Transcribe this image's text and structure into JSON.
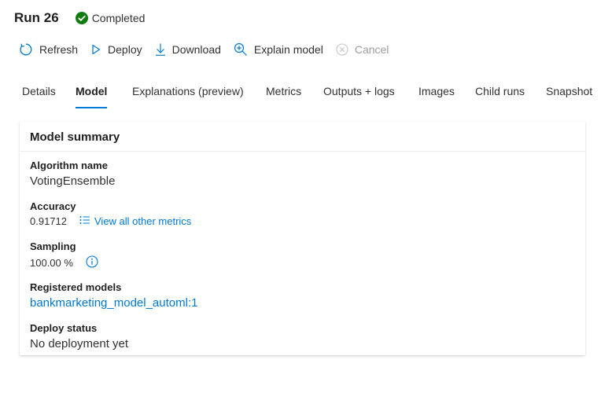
{
  "header": {
    "title": "Run 26",
    "status_label": "Completed",
    "status_color": "#107c10"
  },
  "toolbar": {
    "refresh_label": "Refresh",
    "deploy_label": "Deploy",
    "download_label": "Download",
    "explain_label": "Explain model",
    "cancel_label": "Cancel"
  },
  "tabs": [
    {
      "label": "Details"
    },
    {
      "label": "Model",
      "active": true
    },
    {
      "label": "Explanations (preview)"
    },
    {
      "label": "Metrics"
    },
    {
      "label": "Outputs + logs"
    },
    {
      "label": "Images"
    },
    {
      "label": "Child runs"
    },
    {
      "label": "Snapshot"
    }
  ],
  "summary": {
    "title": "Model summary",
    "algorithm_label": "Algorithm name",
    "algorithm_value": "VotingEnsemble",
    "accuracy_label": "Accuracy",
    "accuracy_value": "0.91712",
    "metrics_link": "View all other metrics",
    "sampling_label": "Sampling",
    "sampling_value": "100.00 %",
    "registered_label": "Registered models",
    "registered_value": "bankmarketing_model_automl:1",
    "deploy_label": "Deploy status",
    "deploy_value": "No deployment yet"
  },
  "colors": {
    "accent": "#0078d4",
    "success": "#107c10"
  }
}
